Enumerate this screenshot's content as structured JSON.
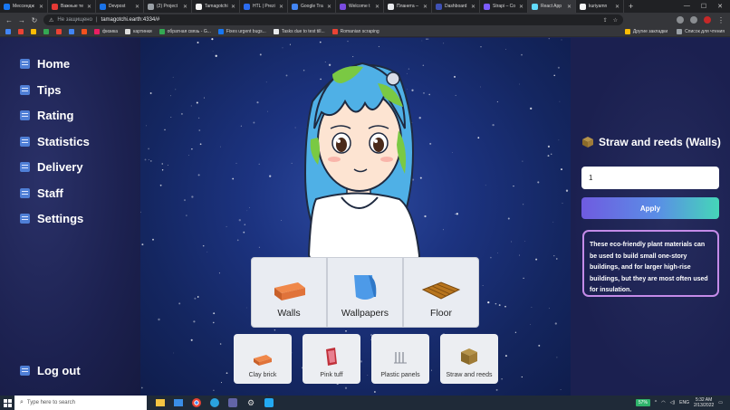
{
  "browser": {
    "tabs": [
      {
        "label": "Мессендж",
        "color": "#1877f2"
      },
      {
        "label": "Важные те",
        "color": "#e53935"
      },
      {
        "label": "Devpost",
        "color": "#1a73e8"
      },
      {
        "label": "(2) Project",
        "color": "#9aa0a6"
      },
      {
        "label": "Tamagotchi",
        "color": "#f5f5f5"
      },
      {
        "label": "HTL | Prezi",
        "color": "#2b6cf0"
      },
      {
        "label": "Google Tra",
        "color": "#4285f4"
      },
      {
        "label": "Welcome t",
        "color": "#7a4be0"
      },
      {
        "label": "Планета –",
        "color": "#e8eaed"
      },
      {
        "label": "Dashboard",
        "color": "#3f51b5"
      },
      {
        "label": "Strapi – Co",
        "color": "#7c5cff"
      },
      {
        "label": "React App",
        "color": "#61dafb"
      },
      {
        "label": "kuriyamn",
        "color": "#f5f5f5"
      }
    ],
    "active_tab": 11,
    "security_label": "Не защищено",
    "url": "tamagotchi.earth:4334/#",
    "bookmarks": [
      {
        "label": "",
        "color": "#4285f4"
      },
      {
        "label": "",
        "color": "#ea4335"
      },
      {
        "label": "",
        "color": "#fbbc05"
      },
      {
        "label": "",
        "color": "#34a853"
      },
      {
        "label": "",
        "color": "#ea4335"
      },
      {
        "label": "",
        "color": "#4285f4"
      },
      {
        "label": "",
        "color": "#f4511e"
      },
      {
        "label": "физика",
        "color": "#e91e63"
      },
      {
        "label": "картинки",
        "color": "#dddddd"
      },
      {
        "label": "обратная связь - G...",
        "color": "#34a853"
      },
      {
        "label": "Fixes urgent bugs...",
        "color": "#1877f2"
      },
      {
        "label": "Tasks due to test till...",
        "color": "#e8eaed"
      },
      {
        "label": "Romanian scraping",
        "color": "#ea4335"
      }
    ],
    "bookmarks_right": [
      "Другие закладки",
      "Список для чтения"
    ]
  },
  "sidebar": {
    "items": [
      {
        "label": "Home"
      },
      {
        "label": "Tips"
      },
      {
        "label": "Rating"
      },
      {
        "label": "Statistics"
      },
      {
        "label": "Delivery"
      },
      {
        "label": "Staff"
      },
      {
        "label": "Settings"
      }
    ],
    "logout_label": "Log out"
  },
  "categories": [
    {
      "label": "Walls",
      "icon": "brick-wall-icon"
    },
    {
      "label": "Wallpapers",
      "icon": "wallpaper-roll-icon"
    },
    {
      "label": "Floor",
      "icon": "parquet-floor-icon"
    }
  ],
  "materials": [
    {
      "label": "Clay brick",
      "icon": "clay-brick-icon"
    },
    {
      "label": "Pink tuff",
      "icon": "pink-tuff-icon"
    },
    {
      "label": "Plastic panels",
      "icon": "plastic-panels-icon"
    },
    {
      "label": "Straw and reeds",
      "icon": "straw-reeds-icon"
    }
  ],
  "detail": {
    "title": "Straw and reeds (Walls)",
    "quantity": "1",
    "apply_label": "Apply",
    "description": "These eco-friendly plant materials can be used to build small one-story buildings, and for larger high-rise buildings, but they are most often used for insulation."
  },
  "taskbar": {
    "search_placeholder": "Type here to search",
    "battery": "57%",
    "language": "ENG",
    "time": "5:32 AM",
    "date": "2/13/2022"
  },
  "colors": {
    "accent_purple": "#6f5be0",
    "accent_teal": "#45d6b8",
    "desc_border": "#c48be8",
    "sidebar_icon": "#4f7fd6"
  }
}
